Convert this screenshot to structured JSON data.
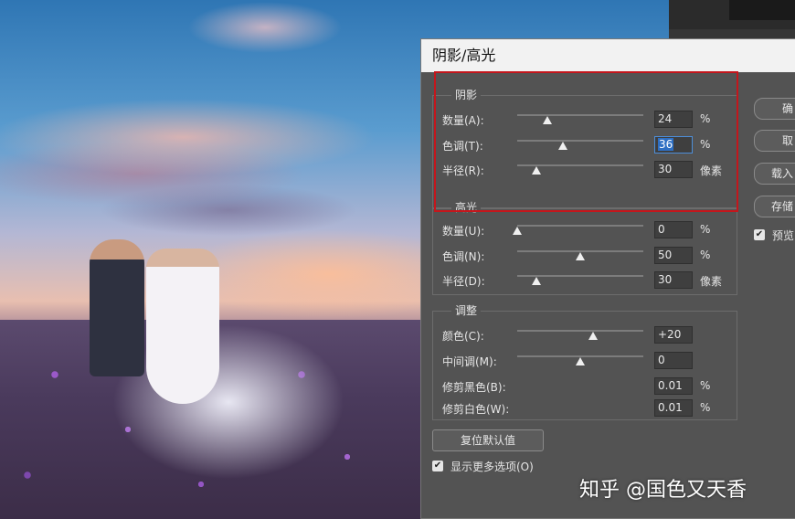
{
  "dialog": {
    "title": "阴影/高光",
    "shadows": {
      "title": "阴影",
      "rows": [
        {
          "label": "数量(A):",
          "value": "24",
          "unit": "%",
          "level": 0.24
        },
        {
          "label": "色调(T):",
          "value": "36",
          "unit": "%",
          "level": 0.36
        },
        {
          "label": "半径(R):",
          "value": "30",
          "unit": "像素",
          "level": 0.15
        }
      ]
    },
    "highlights": {
      "title": "高光",
      "rows": [
        {
          "label": "数量(U):",
          "value": "0",
          "unit": "%",
          "level": 0.0
        },
        {
          "label": "色调(N):",
          "value": "50",
          "unit": "%",
          "level": 0.5
        },
        {
          "label": "半径(D):",
          "value": "30",
          "unit": "像素",
          "level": 0.15
        }
      ]
    },
    "adjustments": {
      "title": "调整",
      "rows": [
        {
          "label": "颜色(C):",
          "value": "+20",
          "unit": "",
          "level": 0.6,
          "slider": true
        },
        {
          "label": "中间调(M):",
          "value": "0",
          "unit": "",
          "level": 0.5,
          "slider": true
        },
        {
          "label": "修剪黑色(B):",
          "value": "0.01",
          "unit": "%",
          "slider": false
        },
        {
          "label": "修剪白色(W):",
          "value": "0.01",
          "unit": "%",
          "slider": false
        }
      ]
    },
    "reset_button": "复位默认值",
    "more_options": {
      "label": "显示更多选项(O)",
      "checked": true
    },
    "side_buttons": {
      "ok": "确",
      "cancel": "取",
      "load": "载入",
      "save": "存储"
    },
    "preview": {
      "label": "预览",
      "checked": true
    }
  },
  "watermark": "知乎 @国色又天香",
  "colors": {
    "dialog_bg": "#535353",
    "highlight_box": "#c4161c",
    "focus_blue": "#2e6fc3"
  }
}
